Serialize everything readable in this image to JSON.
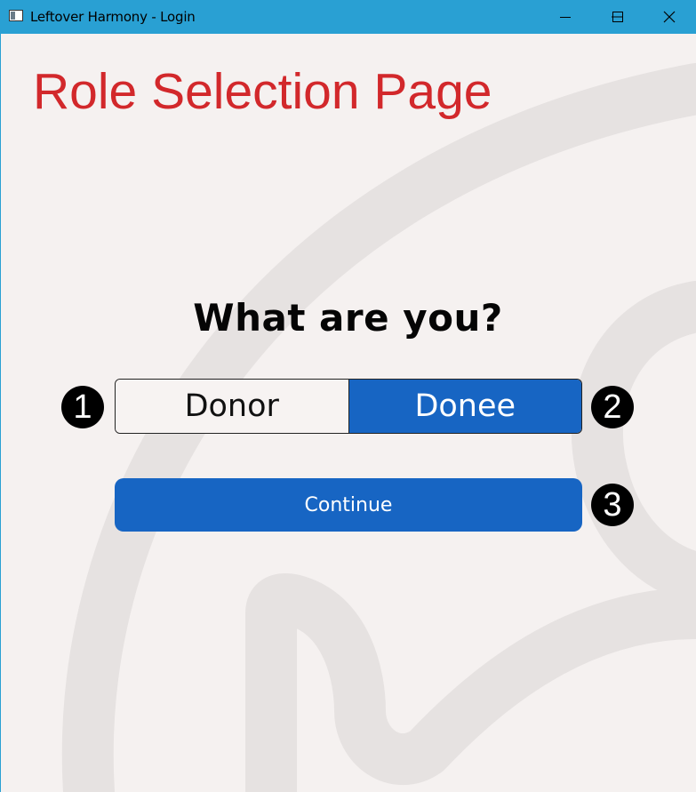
{
  "window": {
    "title": "Leftover Harmony - Login",
    "controls": [
      "minimize",
      "maximize",
      "close"
    ]
  },
  "page": {
    "title": "Role Selection Page",
    "question": "What are you?"
  },
  "role_selector": {
    "options": [
      {
        "label": "Donor",
        "selected": false
      },
      {
        "label": "Donee",
        "selected": true
      }
    ]
  },
  "continue_button": {
    "label": "Continue"
  },
  "annotations": [
    "1",
    "2",
    "3"
  ],
  "colors": {
    "titlebar": "#29a0d3",
    "page_title": "#d2282b",
    "accent": "#1765c3",
    "background": "#f5f1f0",
    "watermark": "#e6e2e1"
  }
}
